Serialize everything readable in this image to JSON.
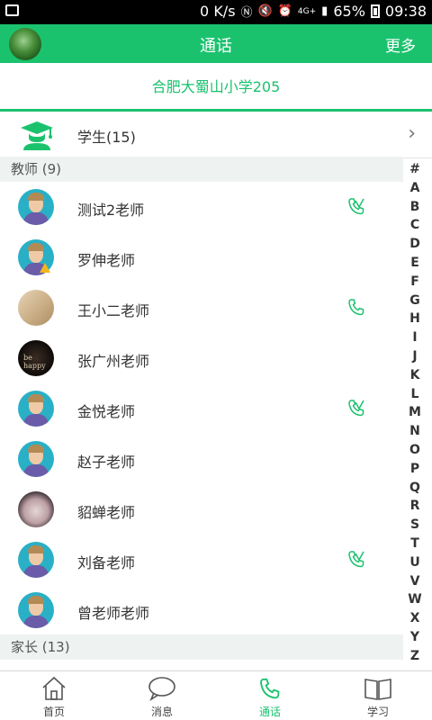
{
  "status_bar": {
    "speed": "0 K/s",
    "network": "4G+",
    "battery": "65%",
    "time": "09:38"
  },
  "header": {
    "title": "通话",
    "more": "更多"
  },
  "school_name": "合肥大蜀山小学205",
  "students_label": "学生(15)",
  "sections": {
    "teachers": "教师 (9)",
    "parents": "家长 (13)"
  },
  "teachers": [
    {
      "name": "测试2老师",
      "avatar": "default-avatar",
      "phone": "phone-video-icon"
    },
    {
      "name": "罗伸老师",
      "avatar": "default-avatar-warning",
      "phone": ""
    },
    {
      "name": "王小二老师",
      "avatar": "photo-avatar",
      "phone": "phone-icon"
    },
    {
      "name": "张广州老师",
      "avatar": "photo-avatar",
      "phone": ""
    },
    {
      "name": "金悦老师",
      "avatar": "default-avatar",
      "phone": "phone-video-icon"
    },
    {
      "name": "赵子老师",
      "avatar": "default-avatar",
      "phone": ""
    },
    {
      "name": "貂蝉老师",
      "avatar": "photo-avatar",
      "phone": ""
    },
    {
      "name": "刘备老师",
      "avatar": "default-avatar",
      "phone": "phone-video-icon"
    },
    {
      "name": "曾老师老师",
      "avatar": "default-avatar",
      "phone": ""
    }
  ],
  "index_letters": [
    "#",
    "A",
    "B",
    "C",
    "D",
    "E",
    "F",
    "G",
    "H",
    "I",
    "J",
    "K",
    "L",
    "M",
    "N",
    "O",
    "P",
    "Q",
    "R",
    "S",
    "T",
    "U",
    "V",
    "W",
    "X",
    "Y",
    "Z"
  ],
  "tabs": [
    {
      "label": "首页",
      "icon": "home-icon"
    },
    {
      "label": "消息",
      "icon": "chat-icon"
    },
    {
      "label": "通话",
      "icon": "phone-icon"
    },
    {
      "label": "学习",
      "icon": "book-icon"
    }
  ],
  "colors": {
    "brand": "#1bc26e",
    "section_bg": "#eef3f1",
    "default_avatar_bg": "#2ab0c6"
  }
}
